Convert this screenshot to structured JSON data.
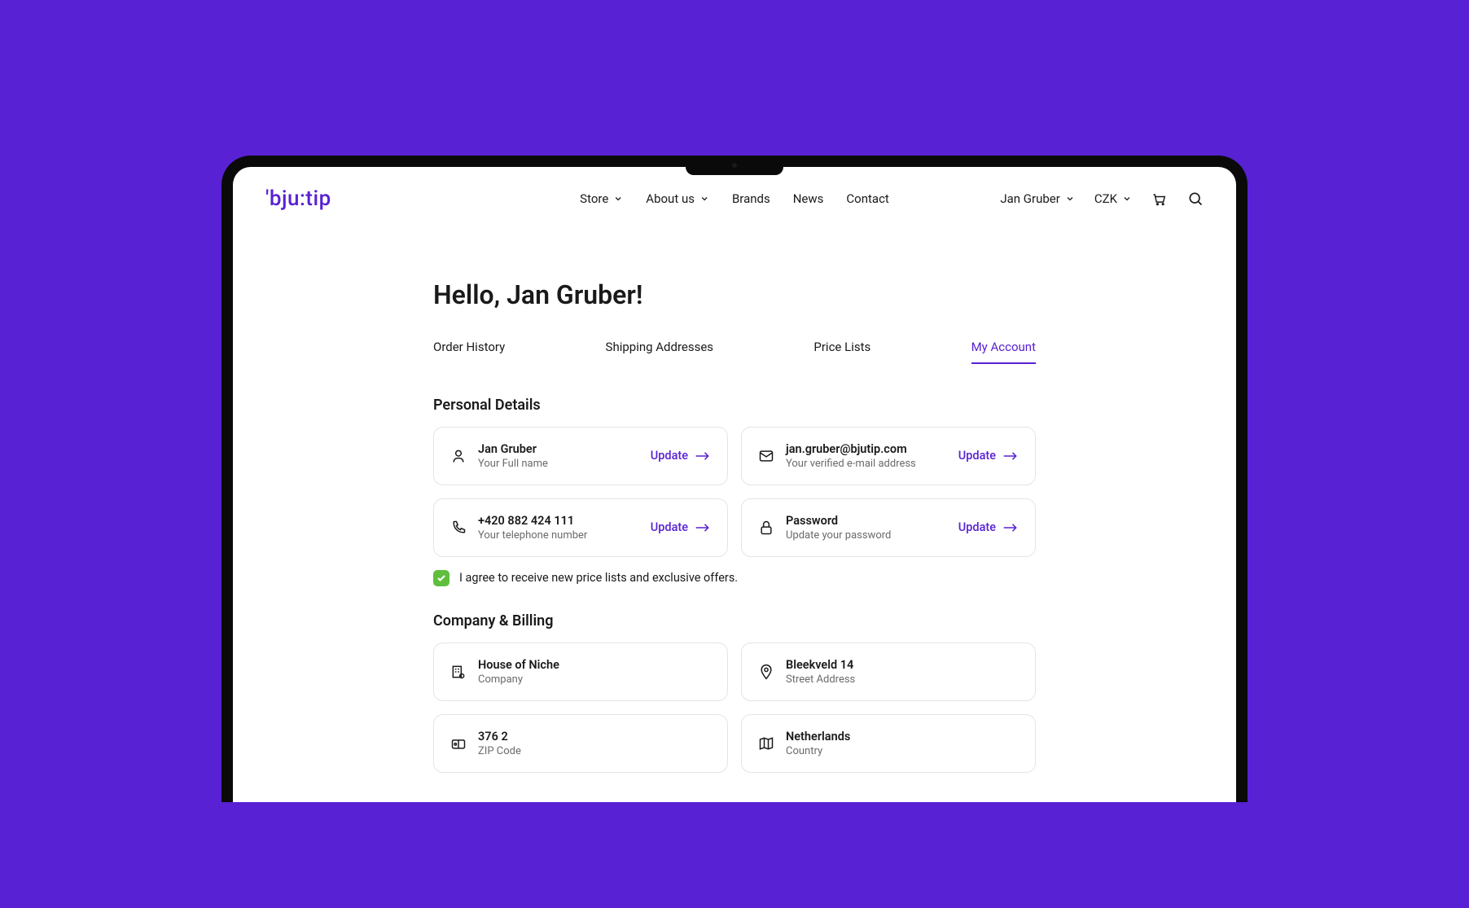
{
  "logo": "'bju:tip",
  "nav": {
    "store": "Store",
    "about_us": "About us",
    "brands": "Brands",
    "news": "News",
    "contact": "Contact"
  },
  "user": {
    "name": "Jan Gruber",
    "currency": "CZK"
  },
  "page_title": "Hello, Jan Gruber!",
  "tabs": {
    "order_history": "Order History",
    "shipping_addresses": "Shipping Addresses",
    "price_lists": "Price Lists",
    "my_account": "My Account"
  },
  "personal_details": {
    "section_title": "Personal Details",
    "full_name": {
      "value": "Jan Gruber",
      "label": "Your Full name"
    },
    "email": {
      "value": "jan.gruber@bjutip.com",
      "label": "Your verified e-mail address"
    },
    "phone": {
      "value": "+420 882 424 111",
      "label": "Your telephone number"
    },
    "password": {
      "value": "Password",
      "label": "Update your password"
    },
    "update_label": "Update",
    "consent_label": "I agree to receive new price lists and exclusive offers."
  },
  "company_billing": {
    "section_title": "Company & Billing",
    "company": {
      "value": "House of Niche",
      "label": "Company"
    },
    "street": {
      "value": "Bleekveld 14",
      "label": "Street Address"
    },
    "zip": {
      "value": "376 2",
      "label": "ZIP Code"
    },
    "country": {
      "value": "Netherlands",
      "label": "Country"
    }
  }
}
